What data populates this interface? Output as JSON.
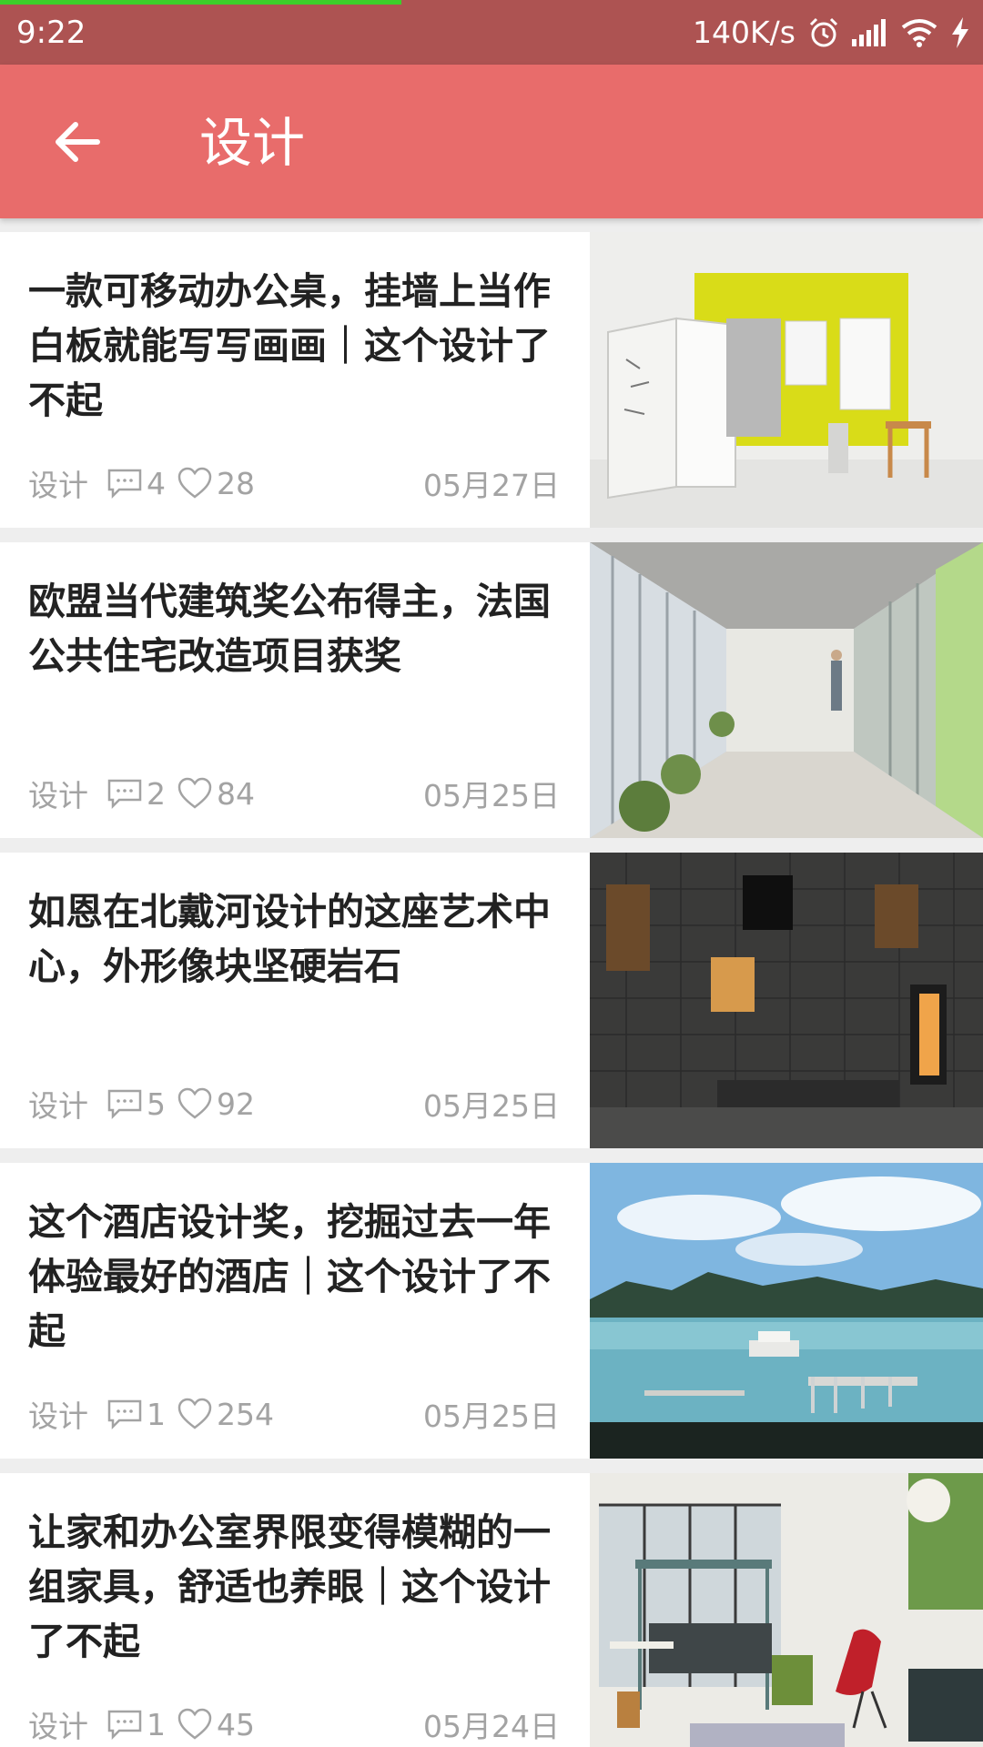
{
  "status_bar": {
    "time": "9:22",
    "net_speed": "140K/s",
    "icons": [
      "alarm-icon",
      "signal-icon",
      "wifi-icon",
      "charging-icon"
    ],
    "load_progress": 0.41
  },
  "app_bar": {
    "back_icon": "arrow-left-icon",
    "title": "设计"
  },
  "colors": {
    "status_bar": "#ad5352",
    "app_bar": "#e86c6b",
    "progress": "#3ccf2a",
    "meta_text": "#a3a3a3",
    "title_text": "#222222"
  },
  "articles": [
    {
      "title": "一款可移动办公桌，挂墙上当作白板就能写写画画｜这个设计了不起",
      "category": "设计",
      "comments": "4",
      "likes": "28",
      "date": "05月27日",
      "thumbnail": "movable-whiteboard-desk-photo"
    },
    {
      "title": "欧盟当代建筑奖公布得主，法国公共住宅改造项目获奖",
      "category": "设计",
      "comments": "2",
      "likes": "84",
      "date": "05月25日",
      "thumbnail": "glass-balcony-corridor-photo"
    },
    {
      "title": "如恩在北戴河设计的这座艺术中心，外形像块坚硬岩石",
      "category": "设计",
      "comments": "5",
      "likes": "92",
      "date": "05月25日",
      "thumbnail": "dark-stone-art-center-photo"
    },
    {
      "title": "这个酒店设计奖，挖掘过去一年体验最好的酒店｜这个设计了不起",
      "category": "设计",
      "comments": "1",
      "likes": "254",
      "date": "05月25日",
      "thumbnail": "floating-hotel-bay-photo"
    },
    {
      "title": "让家和办公室界限变得模糊的一组家具，舒适也养眼｜这个设计了不起",
      "category": "设计",
      "comments": "1",
      "likes": "45",
      "date": "05月24日",
      "thumbnail": "home-office-furniture-photo"
    }
  ]
}
